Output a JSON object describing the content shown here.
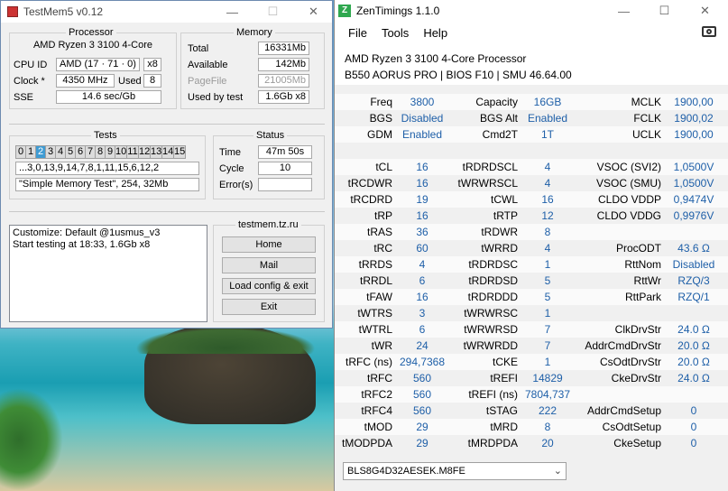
{
  "testmem": {
    "title": "TestMem5 v0.12",
    "processor_group": "Processor",
    "cpu_name": "AMD Ryzen 3 3100 4-Core",
    "cpuid_label": "CPU ID",
    "cpuid_value": "AMD  (17 · 71 · 0)",
    "cpuid_x": "x8",
    "clock_label": "Clock *",
    "clock_value": "4350 MHz",
    "used_label": "Used",
    "used_value": "8",
    "sse_label": "SSE",
    "sse_value": "14.6 sec/Gb",
    "memory_group": "Memory",
    "total_label": "Total",
    "total_value": "16331Mb",
    "available_label": "Available",
    "available_value": "142Mb",
    "pagefile_label": "PageFile",
    "pagefile_value": "21005Mb",
    "usedbytest_label": "Used by test",
    "usedbytest_value": "1.6Gb x8",
    "tests_group": "Tests",
    "test_cells": [
      "0",
      "1",
      "2",
      "3",
      "4",
      "5",
      "6",
      "7",
      "8",
      "9",
      "10",
      "11",
      "12",
      "13",
      "14",
      "15"
    ],
    "active_test": "2",
    "sequence": "...3,0,13,9,14,7,8,1,11,15,6,12,2",
    "test_name": "\"Simple Memory Test\", 254, 32Mb",
    "status_group": "Status",
    "time_label": "Time",
    "time_value": "47m 50s",
    "cycle_label": "Cycle",
    "cycle_value": "10",
    "errors_label": "Error(s)",
    "errors_value": "",
    "log_line1": "Customize: Default @1usmus_v3",
    "log_line2": "Start testing at 18:33, 1.6Gb x8",
    "site_group": "testmem.tz.ru",
    "btn_home": "Home",
    "btn_mail": "Mail",
    "btn_load": "Load config & exit",
    "btn_exit": "Exit"
  },
  "zentimings": {
    "title": "ZenTimings 1.1.0",
    "logo": "Z",
    "menu": [
      "File",
      "Tools",
      "Help"
    ],
    "cpu": "AMD Ryzen 3 3100 4-Core Processor",
    "board": "B550 AORUS PRO | BIOS F10 | SMU 46.64.00",
    "rows": [
      {
        "k1": "Freq",
        "v1": "3800",
        "k2": "Capacity",
        "v2": "16GB",
        "k3": "MCLK",
        "v3": "1900,00"
      },
      {
        "k1": "BGS",
        "v1": "Disabled",
        "k2": "BGS Alt",
        "v2": "Enabled",
        "k3": "FCLK",
        "v3": "1900,02"
      },
      {
        "k1": "GDM",
        "v1": "Enabled",
        "k2": "Cmd2T",
        "v2": "1T",
        "k3": "UCLK",
        "v3": "1900,00"
      },
      {
        "k1": "",
        "v1": "",
        "k2": "",
        "v2": "",
        "k3": "",
        "v3": ""
      },
      {
        "k1": "tCL",
        "v1": "16",
        "k2": "tRDRDSCL",
        "v2": "4",
        "k3": "VSOC (SVI2)",
        "v3": "1,0500V"
      },
      {
        "k1": "tRCDWR",
        "v1": "16",
        "k2": "tWRWRSCL",
        "v2": "4",
        "k3": "VSOC (SMU)",
        "v3": "1,0500V"
      },
      {
        "k1": "tRCDRD",
        "v1": "19",
        "k2": "tCWL",
        "v2": "16",
        "k3": "CLDO VDDP",
        "v3": "0,9474V"
      },
      {
        "k1": "tRP",
        "v1": "16",
        "k2": "tRTP",
        "v2": "12",
        "k3": "CLDO VDDG",
        "v3": "0,9976V"
      },
      {
        "k1": "tRAS",
        "v1": "36",
        "k2": "tRDWR",
        "v2": "8",
        "k3": "",
        "v3": ""
      },
      {
        "k1": "tRC",
        "v1": "60",
        "k2": "tWRRD",
        "v2": "4",
        "k3": "ProcODT",
        "v3": "43.6 Ω"
      },
      {
        "k1": "tRRDS",
        "v1": "4",
        "k2": "tRDRDSC",
        "v2": "1",
        "k3": "RttNom",
        "v3": "Disabled"
      },
      {
        "k1": "tRRDL",
        "v1": "6",
        "k2": "tRDRDSD",
        "v2": "5",
        "k3": "RttWr",
        "v3": "RZQ/3"
      },
      {
        "k1": "tFAW",
        "v1": "16",
        "k2": "tRDRDDD",
        "v2": "5",
        "k3": "RttPark",
        "v3": "RZQ/1"
      },
      {
        "k1": "tWTRS",
        "v1": "3",
        "k2": "tWRWRSC",
        "v2": "1",
        "k3": "",
        "v3": ""
      },
      {
        "k1": "tWTRL",
        "v1": "6",
        "k2": "tWRWRSD",
        "v2": "7",
        "k3": "ClkDrvStr",
        "v3": "24.0 Ω"
      },
      {
        "k1": "tWR",
        "v1": "24",
        "k2": "tWRWRDD",
        "v2": "7",
        "k3": "AddrCmdDrvStr",
        "v3": "20.0 Ω"
      },
      {
        "k1": "tRFC (ns)",
        "v1": "294,7368",
        "k2": "tCKE",
        "v2": "1",
        "k3": "CsOdtDrvStr",
        "v3": "20.0 Ω"
      },
      {
        "k1": "tRFC",
        "v1": "560",
        "k2": "tREFI",
        "v2": "14829",
        "k3": "CkeDrvStr",
        "v3": "24.0 Ω"
      },
      {
        "k1": "tRFC2",
        "v1": "560",
        "k2": "tREFI (ns)",
        "v2": "7804,737",
        "k3": "",
        "v3": ""
      },
      {
        "k1": "tRFC4",
        "v1": "560",
        "k2": "tSTAG",
        "v2": "222",
        "k3": "AddrCmdSetup",
        "v3": "0"
      },
      {
        "k1": "tMOD",
        "v1": "29",
        "k2": "tMRD",
        "v2": "8",
        "k3": "CsOdtSetup",
        "v3": "0"
      },
      {
        "k1": "tMODPDA",
        "v1": "29",
        "k2": "tMRDPDA",
        "v2": "20",
        "k3": "CkeSetup",
        "v3": "0"
      }
    ],
    "module_select": "BLS8G4D32AESEK.M8FE"
  },
  "colors": {
    "value_blue": "#1e5fa8",
    "active_cell": "#3e9bd3",
    "logo_green": "#2fa84f"
  }
}
